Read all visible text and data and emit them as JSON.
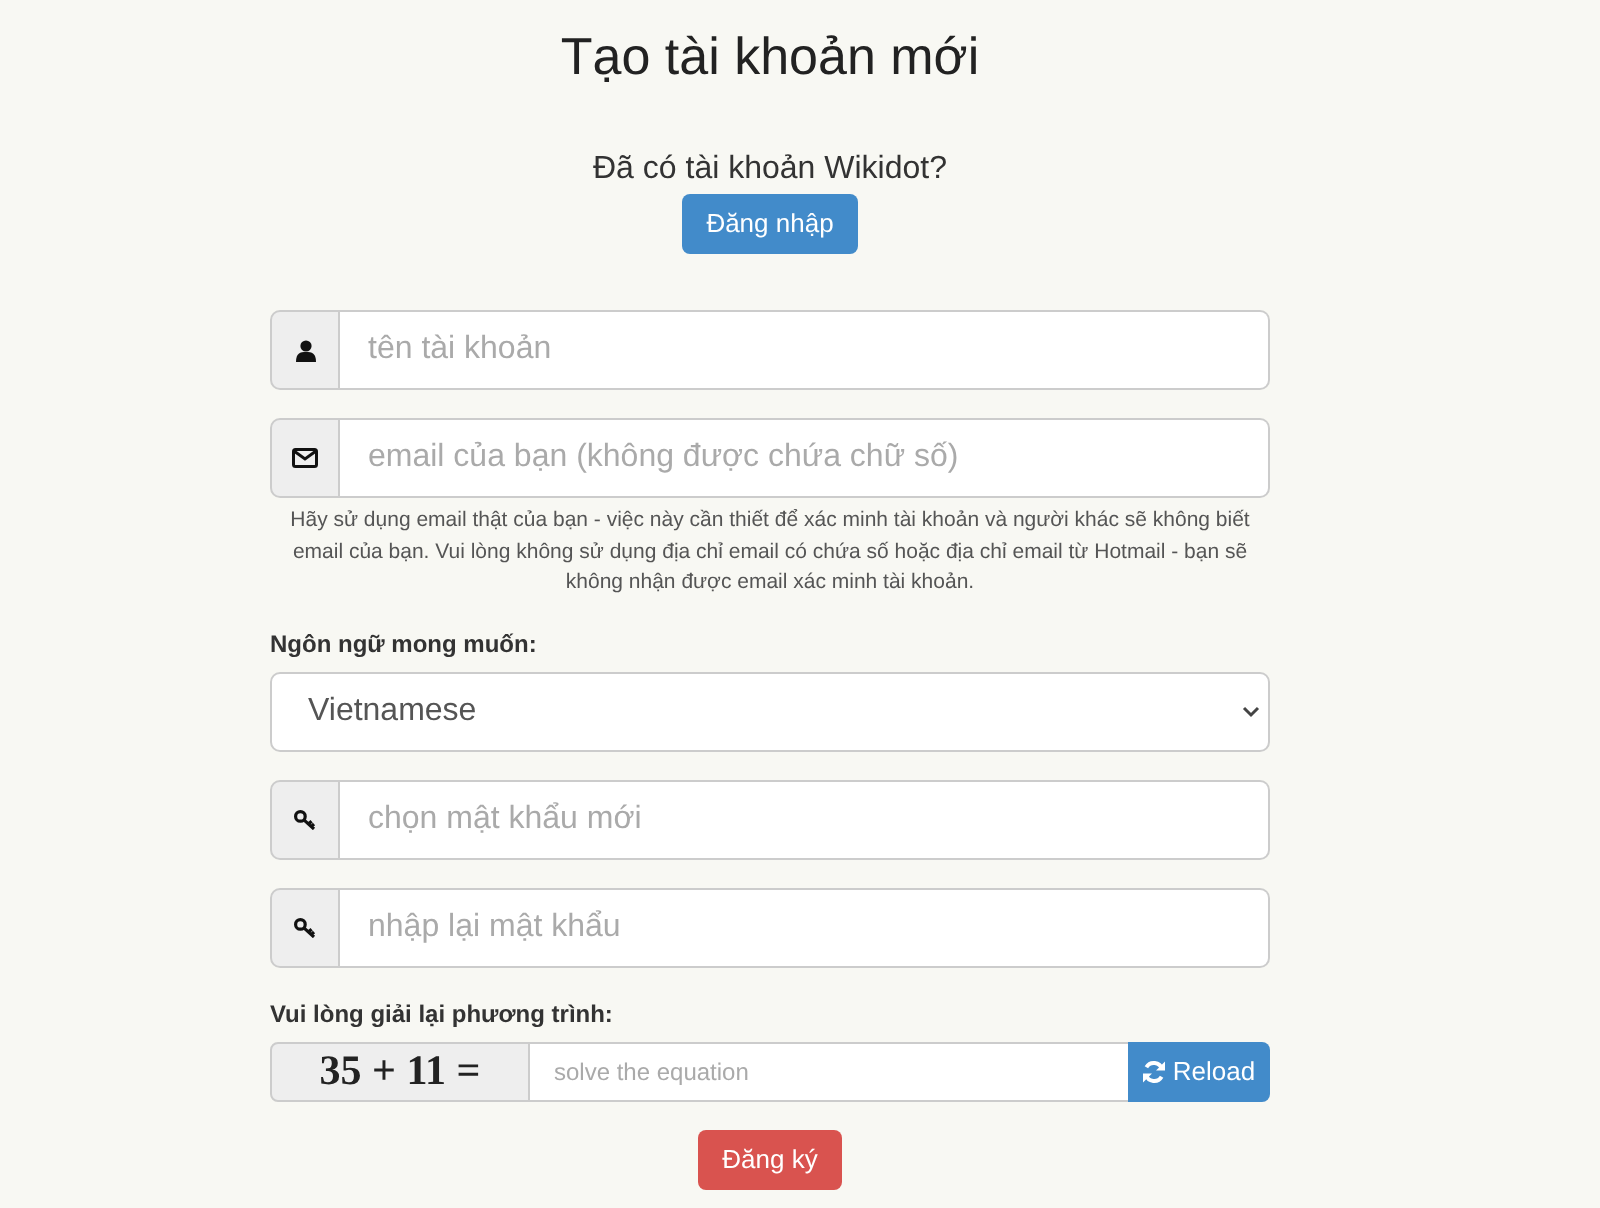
{
  "title": "Tạo tài khoản mới",
  "login_prompt": {
    "text": "Đã có tài khoản Wikidot?",
    "button": "Đăng nhập"
  },
  "fields": [
    {
      "kind": "username",
      "placeholder": "tên tài khoản"
    },
    {
      "kind": "email",
      "placeholder": "email của bạn (không được chứa chữ số)",
      "help": "Hãy sử dụng email thật của bạn - việc này cần thiết để xác minh tài khoản và người khác sẽ không biết email của bạn. Vui lòng không sử dụng địa chỉ email có chứa số hoặc địa chỉ email từ Hotmail - bạn sẽ không nhận được email xác minh tài khoản."
    },
    {
      "kind": "select",
      "label": "Ngôn ngữ mong muốn:",
      "value": "Vietnamese"
    },
    {
      "kind": "password",
      "placeholder": "chọn mật khẩu mới"
    },
    {
      "kind": "password",
      "placeholder": "nhập lại mật khẩu"
    }
  ],
  "captcha": {
    "label": "Vui lòng giải lại phương trình:",
    "equation": "35 + 11 =",
    "placeholder": "solve the equation",
    "button": "Reload"
  },
  "submit": "Đăng ký"
}
